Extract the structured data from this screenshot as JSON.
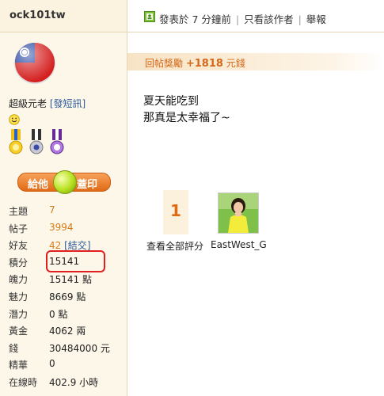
{
  "author": {
    "name": "ock101tw",
    "rank": "超級元老",
    "pm_link": "發短訊"
  },
  "rate_button": {
    "left": "給他",
    "right": "蓋印"
  },
  "stats": [
    {
      "key": "主題",
      "value": "7",
      "style": "orange"
    },
    {
      "key": "帖子",
      "value": "3994",
      "style": "orange"
    },
    {
      "key": "好友",
      "value": "42",
      "style": "orange",
      "extra": "結交"
    },
    {
      "key": "積分",
      "value": "15141"
    },
    {
      "key": "魄力",
      "value": "15141 點"
    },
    {
      "key": "魅力",
      "value": "8669 點"
    },
    {
      "key": "潛力",
      "value": "0 點"
    },
    {
      "key": "黃金",
      "value": "4062 兩"
    },
    {
      "key": "錢",
      "value": "30484000 元"
    },
    {
      "key": "精華",
      "value": "0"
    },
    {
      "key": "在線時",
      "value": "402.9 小時"
    }
  ],
  "topbar": {
    "posted": "發表於 7 分鐘前",
    "only_author": "只看該作者",
    "report": "舉報"
  },
  "reward": {
    "label": "回帖獎勵",
    "amount": "+1818",
    "unit": "元錢"
  },
  "post": {
    "line1": "夏天能吃到",
    "line2": "那真是太幸福了~"
  },
  "rating": {
    "count": "1",
    "view_all": "查看全部評分",
    "rater": "EastWest_G"
  },
  "colors": {
    "accent": "#d87a14",
    "sidebar_bg": "#fdf7ea",
    "border": "#e3d6b6"
  }
}
